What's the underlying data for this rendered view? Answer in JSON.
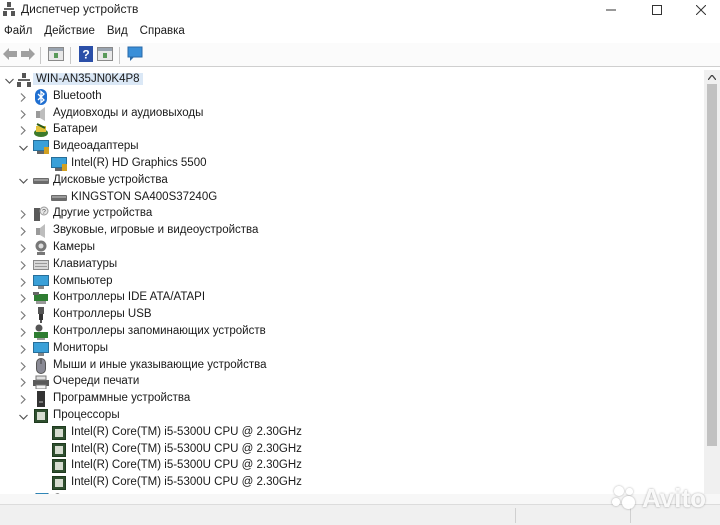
{
  "window": {
    "title": "Диспетчер устройств",
    "controls": [
      "minimize",
      "maximize",
      "close"
    ]
  },
  "menu": {
    "items": [
      "Файл",
      "Действие",
      "Вид",
      "Справка"
    ]
  },
  "toolbar": {
    "buttons": [
      "back-arrow",
      "forward-arrow",
      "properties",
      "help",
      "show-hide-console-tree",
      "scan-hardware-monitor"
    ]
  },
  "tree": {
    "root": "WIN-AN35JN0K4P8",
    "categories": [
      {
        "label": "Bluetooth",
        "icon": "bluetooth-icon",
        "expanded": false
      },
      {
        "label": "Аудиовходы и аудиовыходы",
        "icon": "speaker-icon",
        "expanded": false
      },
      {
        "label": "Батареи",
        "icon": "battery-icon",
        "expanded": false
      },
      {
        "label": "Видеоадаптеры",
        "icon": "display-adapter-icon",
        "expanded": true,
        "children": [
          "Intel(R) HD Graphics 5500"
        ]
      },
      {
        "label": "Дисковые устройства",
        "icon": "disk-drive-icon",
        "expanded": true,
        "children": [
          "KINGSTON SA400S37240G"
        ]
      },
      {
        "label": "Другие устройства",
        "icon": "unknown-device-icon",
        "expanded": false
      },
      {
        "label": "Звуковые, игровые и видеоустройства",
        "icon": "speaker-icon",
        "expanded": false
      },
      {
        "label": "Камеры",
        "icon": "camera-icon",
        "expanded": false
      },
      {
        "label": "Клавиатуры",
        "icon": "keyboard-icon",
        "expanded": false
      },
      {
        "label": "Компьютер",
        "icon": "computer-icon",
        "expanded": false
      },
      {
        "label": "Контроллеры IDE ATA/ATAPI",
        "icon": "ide-controller-icon",
        "expanded": false
      },
      {
        "label": "Контроллеры USB",
        "icon": "usb-icon",
        "expanded": false
      },
      {
        "label": "Контроллеры запоминающих устройств",
        "icon": "storage-controller-icon",
        "expanded": false
      },
      {
        "label": "Мониторы",
        "icon": "monitor-icon",
        "expanded": false
      },
      {
        "label": "Мыши и иные указывающие устройства",
        "icon": "mouse-icon",
        "expanded": false
      },
      {
        "label": "Очереди печати",
        "icon": "printer-icon",
        "expanded": false
      },
      {
        "label": "Программные устройства",
        "icon": "software-device-icon",
        "expanded": false
      },
      {
        "label": "Процессоры",
        "icon": "processor-icon",
        "expanded": true,
        "children": [
          "Intel(R) Core(TM) i5-5300U CPU @ 2.30GHz",
          "Intel(R) Core(TM) i5-5300U CPU @ 2.30GHz",
          "Intel(R) Core(TM) i5-5300U CPU @ 2.30GHz",
          "Intel(R) Core(TM) i5-5300U CPU @ 2.30GHz"
        ]
      },
      {
        "label": "Сетевые адаптеры",
        "icon": "network-adapter-icon",
        "expanded": false
      }
    ]
  },
  "watermark": {
    "text": "Avito"
  }
}
